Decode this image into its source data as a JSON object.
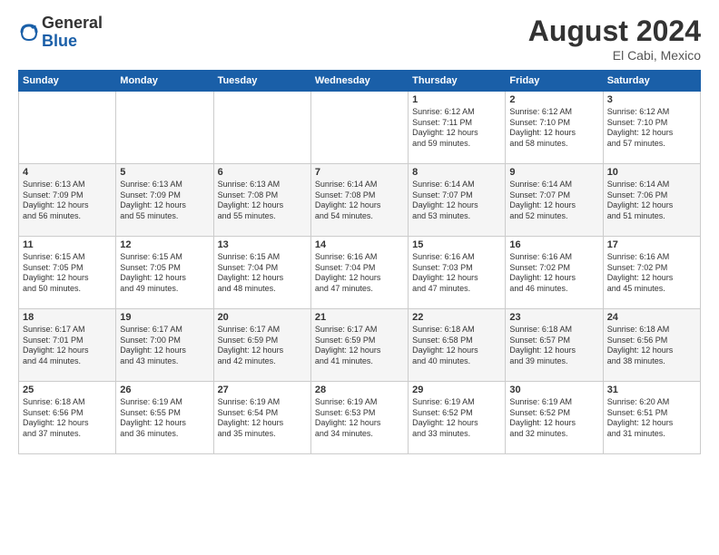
{
  "logo": {
    "general": "General",
    "blue": "Blue"
  },
  "title": "August 2024",
  "location": "El Cabi, Mexico",
  "days_of_week": [
    "Sunday",
    "Monday",
    "Tuesday",
    "Wednesday",
    "Thursday",
    "Friday",
    "Saturday"
  ],
  "weeks": [
    [
      {
        "day": "",
        "info": ""
      },
      {
        "day": "",
        "info": ""
      },
      {
        "day": "",
        "info": ""
      },
      {
        "day": "",
        "info": ""
      },
      {
        "day": "1",
        "info": "Sunrise: 6:12 AM\nSunset: 7:11 PM\nDaylight: 12 hours\nand 59 minutes."
      },
      {
        "day": "2",
        "info": "Sunrise: 6:12 AM\nSunset: 7:10 PM\nDaylight: 12 hours\nand 58 minutes."
      },
      {
        "day": "3",
        "info": "Sunrise: 6:12 AM\nSunset: 7:10 PM\nDaylight: 12 hours\nand 57 minutes."
      }
    ],
    [
      {
        "day": "4",
        "info": "Sunrise: 6:13 AM\nSunset: 7:09 PM\nDaylight: 12 hours\nand 56 minutes."
      },
      {
        "day": "5",
        "info": "Sunrise: 6:13 AM\nSunset: 7:09 PM\nDaylight: 12 hours\nand 55 minutes."
      },
      {
        "day": "6",
        "info": "Sunrise: 6:13 AM\nSunset: 7:08 PM\nDaylight: 12 hours\nand 55 minutes."
      },
      {
        "day": "7",
        "info": "Sunrise: 6:14 AM\nSunset: 7:08 PM\nDaylight: 12 hours\nand 54 minutes."
      },
      {
        "day": "8",
        "info": "Sunrise: 6:14 AM\nSunset: 7:07 PM\nDaylight: 12 hours\nand 53 minutes."
      },
      {
        "day": "9",
        "info": "Sunrise: 6:14 AM\nSunset: 7:07 PM\nDaylight: 12 hours\nand 52 minutes."
      },
      {
        "day": "10",
        "info": "Sunrise: 6:14 AM\nSunset: 7:06 PM\nDaylight: 12 hours\nand 51 minutes."
      }
    ],
    [
      {
        "day": "11",
        "info": "Sunrise: 6:15 AM\nSunset: 7:05 PM\nDaylight: 12 hours\nand 50 minutes."
      },
      {
        "day": "12",
        "info": "Sunrise: 6:15 AM\nSunset: 7:05 PM\nDaylight: 12 hours\nand 49 minutes."
      },
      {
        "day": "13",
        "info": "Sunrise: 6:15 AM\nSunset: 7:04 PM\nDaylight: 12 hours\nand 48 minutes."
      },
      {
        "day": "14",
        "info": "Sunrise: 6:16 AM\nSunset: 7:04 PM\nDaylight: 12 hours\nand 47 minutes."
      },
      {
        "day": "15",
        "info": "Sunrise: 6:16 AM\nSunset: 7:03 PM\nDaylight: 12 hours\nand 47 minutes."
      },
      {
        "day": "16",
        "info": "Sunrise: 6:16 AM\nSunset: 7:02 PM\nDaylight: 12 hours\nand 46 minutes."
      },
      {
        "day": "17",
        "info": "Sunrise: 6:16 AM\nSunset: 7:02 PM\nDaylight: 12 hours\nand 45 minutes."
      }
    ],
    [
      {
        "day": "18",
        "info": "Sunrise: 6:17 AM\nSunset: 7:01 PM\nDaylight: 12 hours\nand 44 minutes."
      },
      {
        "day": "19",
        "info": "Sunrise: 6:17 AM\nSunset: 7:00 PM\nDaylight: 12 hours\nand 43 minutes."
      },
      {
        "day": "20",
        "info": "Sunrise: 6:17 AM\nSunset: 6:59 PM\nDaylight: 12 hours\nand 42 minutes."
      },
      {
        "day": "21",
        "info": "Sunrise: 6:17 AM\nSunset: 6:59 PM\nDaylight: 12 hours\nand 41 minutes."
      },
      {
        "day": "22",
        "info": "Sunrise: 6:18 AM\nSunset: 6:58 PM\nDaylight: 12 hours\nand 40 minutes."
      },
      {
        "day": "23",
        "info": "Sunrise: 6:18 AM\nSunset: 6:57 PM\nDaylight: 12 hours\nand 39 minutes."
      },
      {
        "day": "24",
        "info": "Sunrise: 6:18 AM\nSunset: 6:56 PM\nDaylight: 12 hours\nand 38 minutes."
      }
    ],
    [
      {
        "day": "25",
        "info": "Sunrise: 6:18 AM\nSunset: 6:56 PM\nDaylight: 12 hours\nand 37 minutes."
      },
      {
        "day": "26",
        "info": "Sunrise: 6:19 AM\nSunset: 6:55 PM\nDaylight: 12 hours\nand 36 minutes."
      },
      {
        "day": "27",
        "info": "Sunrise: 6:19 AM\nSunset: 6:54 PM\nDaylight: 12 hours\nand 35 minutes."
      },
      {
        "day": "28",
        "info": "Sunrise: 6:19 AM\nSunset: 6:53 PM\nDaylight: 12 hours\nand 34 minutes."
      },
      {
        "day": "29",
        "info": "Sunrise: 6:19 AM\nSunset: 6:52 PM\nDaylight: 12 hours\nand 33 minutes."
      },
      {
        "day": "30",
        "info": "Sunrise: 6:19 AM\nSunset: 6:52 PM\nDaylight: 12 hours\nand 32 minutes."
      },
      {
        "day": "31",
        "info": "Sunrise: 6:20 AM\nSunset: 6:51 PM\nDaylight: 12 hours\nand 31 minutes."
      }
    ]
  ]
}
